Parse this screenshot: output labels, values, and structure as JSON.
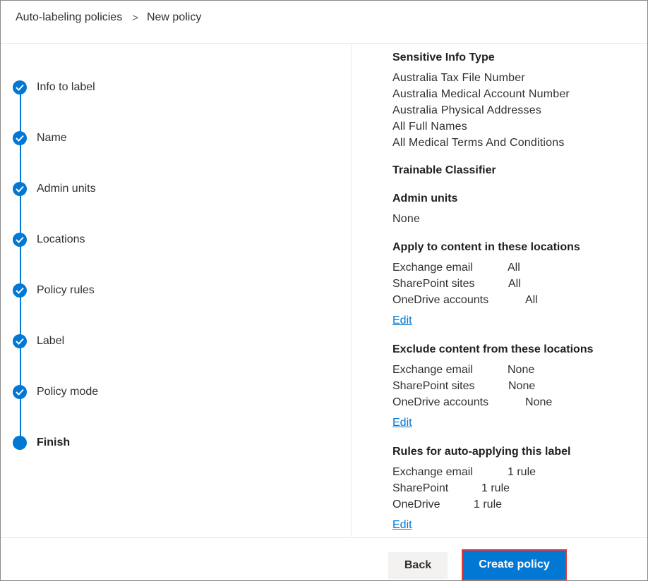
{
  "breadcrumb": {
    "parent": "Auto-labeling policies",
    "separator": ">",
    "current": "New policy"
  },
  "steps": [
    {
      "label": "Info to label",
      "state": "complete"
    },
    {
      "label": "Name",
      "state": "complete"
    },
    {
      "label": "Admin units",
      "state": "complete"
    },
    {
      "label": "Locations",
      "state": "complete"
    },
    {
      "label": "Policy rules",
      "state": "complete"
    },
    {
      "label": "Label",
      "state": "complete"
    },
    {
      "label": "Policy mode",
      "state": "complete"
    },
    {
      "label": "Finish",
      "state": "current"
    }
  ],
  "summary": {
    "sensitive_info_type": {
      "title": "Sensitive Info Type",
      "items": [
        "Australia Tax File Number",
        "Australia Medical Account Number",
        "Australia Physical Addresses",
        "All Full Names",
        "All Medical Terms And Conditions"
      ]
    },
    "trainable_classifier": {
      "title": "Trainable Classifier"
    },
    "admin_units": {
      "title": "Admin units",
      "value": "None"
    },
    "apply_locations": {
      "title": "Apply to content in these locations",
      "rows": [
        {
          "name": "Exchange email",
          "value": "All"
        },
        {
          "name": "SharePoint sites",
          "value": "All"
        },
        {
          "name": "OneDrive accounts",
          "value": "All"
        }
      ],
      "edit": "Edit"
    },
    "exclude_locations": {
      "title": "Exclude content from these locations",
      "rows": [
        {
          "name": "Exchange email",
          "value": "None"
        },
        {
          "name": "SharePoint sites",
          "value": "None"
        },
        {
          "name": "OneDrive accounts",
          "value": "None"
        }
      ],
      "edit": "Edit"
    },
    "rules": {
      "title": "Rules for auto-applying this label",
      "rows": [
        {
          "name": "Exchange email",
          "value": "1 rule"
        },
        {
          "name": "SharePoint",
          "value": "1 rule"
        },
        {
          "name": "OneDrive",
          "value": "1 rule"
        }
      ],
      "edit": "Edit"
    }
  },
  "footer": {
    "back_label": "Back",
    "create_label": "Create policy"
  },
  "colors": {
    "accent": "#0078d4",
    "highlight_border": "#e03a3e"
  }
}
